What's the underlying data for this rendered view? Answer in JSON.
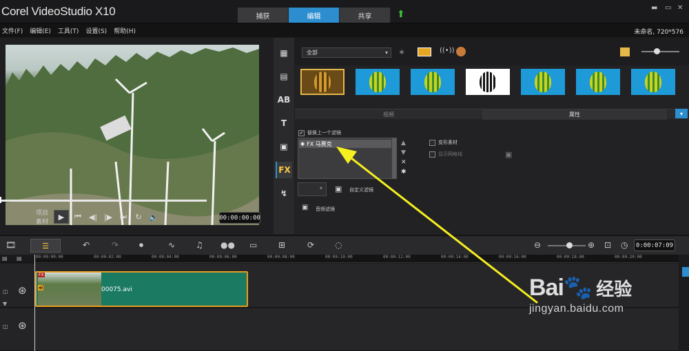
{
  "app": {
    "title": "Corel VideoStudio X10"
  },
  "tabs": [
    {
      "label": "捕获"
    },
    {
      "label": "编辑"
    },
    {
      "label": "共享"
    }
  ],
  "menu": [
    "文件(F)",
    "编辑(E)",
    "工具(T)",
    "设置(S)",
    "帮助(H)"
  ],
  "project_info": "未命名, 720*576",
  "preview": {
    "mode_project": "项目",
    "mode_clip": "素材",
    "timecode": "00:00:00:00"
  },
  "library": {
    "category": "全部",
    "tab_left": "视频",
    "tab_right": "属性",
    "replace_last_filter": "替换上一个滤镜",
    "applied_filter": "FX 马赛克",
    "distort_clip": "变形素材",
    "show_grid": "显示网格线",
    "custom_filter": "自定义滤镜",
    "audio_filter": "音频滤镜"
  },
  "timeline": {
    "timecode": "0:00:07:09",
    "ruler": [
      "00:00:00:00",
      "00:00:02:00",
      "00:00:04:00",
      "00:00:06:00",
      "00:00:08:00",
      "00:00:10:00",
      "00:00:12:00",
      "00:00:14:00",
      "00:00:16:00",
      "00:00:18:00",
      "00:00:20:00"
    ],
    "clip_name": "00075.avi",
    "fx_badge": "FX"
  },
  "watermark": {
    "logo": "Bai",
    "logo_cn": "经验",
    "url": "jingyan.baidu.com"
  },
  "colors": {
    "accent": "#2c8ecf",
    "clip": "#1b7a62",
    "clip_border": "#e8a020",
    "arrow": "#f5f020"
  }
}
